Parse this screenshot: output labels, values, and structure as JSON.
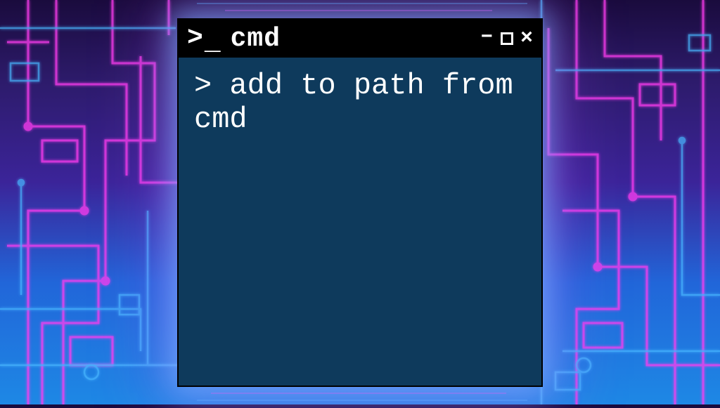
{
  "window": {
    "title": "cmd",
    "prompt_icon_gt": ">",
    "prompt_icon_underscore": "_",
    "controls": {
      "minimize": "–",
      "maximize": "",
      "close": "×"
    }
  },
  "terminal": {
    "prompt": "> ",
    "command": "add to path from cmd"
  },
  "colors": {
    "titlebar_bg": "#000000",
    "terminal_bg": "#0e3a5c",
    "text": "#ffffff",
    "glow_blue": "#78b4ff",
    "glow_magenta": "#c850ff"
  }
}
